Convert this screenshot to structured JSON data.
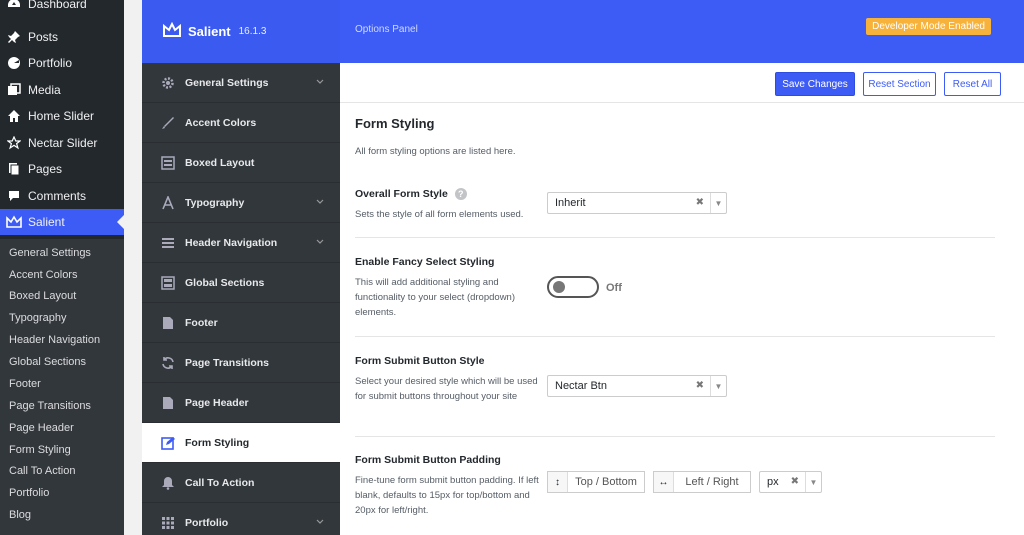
{
  "wp_menu": {
    "items": [
      {
        "label": "Dashboard",
        "icon": "dashboard-icon"
      },
      {
        "label": "Posts",
        "icon": "pin-icon"
      },
      {
        "label": "Portfolio",
        "icon": "portfolio-icon"
      },
      {
        "label": "Media",
        "icon": "media-icon"
      },
      {
        "label": "Home Slider",
        "icon": "home-icon"
      },
      {
        "label": "Nectar Slider",
        "icon": "star-icon"
      },
      {
        "label": "Pages",
        "icon": "pages-icon"
      },
      {
        "label": "Comments",
        "icon": "comments-icon"
      },
      {
        "label": "Salient",
        "icon": "crown-icon"
      }
    ],
    "submenu": [
      "General Settings",
      "Accent Colors",
      "Boxed Layout",
      "Typography",
      "Header Navigation",
      "Global Sections",
      "Footer",
      "Page Transitions",
      "Page Header",
      "Form Styling",
      "Call To Action",
      "Portfolio",
      "Blog"
    ]
  },
  "header": {
    "brand": "Salient",
    "version": "16.1.3",
    "options_panel": "Options Panel",
    "dev_badge": "Developer Mode Enabled"
  },
  "sidebar": {
    "items": [
      {
        "label": "General Settings",
        "icon": "gear-icon",
        "chevron": true
      },
      {
        "label": "Accent Colors",
        "icon": "brush-icon",
        "chevron": false
      },
      {
        "label": "Boxed Layout",
        "icon": "boxed-layout-icon",
        "chevron": false
      },
      {
        "label": "Typography",
        "icon": "typography-icon",
        "chevron": true
      },
      {
        "label": "Header Navigation",
        "icon": "menu-icon",
        "chevron": true
      },
      {
        "label": "Global Sections",
        "icon": "sections-icon",
        "chevron": false
      },
      {
        "label": "Footer",
        "icon": "footer-icon",
        "chevron": false
      },
      {
        "label": "Page Transitions",
        "icon": "refresh-icon",
        "chevron": false
      },
      {
        "label": "Page Header",
        "icon": "page-header-icon",
        "chevron": false
      },
      {
        "label": "Form Styling",
        "icon": "edit-icon",
        "chevron": false
      },
      {
        "label": "Call To Action",
        "icon": "bell-icon",
        "chevron": false
      },
      {
        "label": "Portfolio",
        "icon": "grid-icon",
        "chevron": true
      }
    ]
  },
  "toolbar": {
    "save": "Save Changes",
    "reset_section": "Reset Section",
    "reset_all": "Reset All"
  },
  "section": {
    "title": "Form Styling",
    "description": "All form styling options are listed here."
  },
  "fields": {
    "overall": {
      "label": "Overall Form Style",
      "help": "?",
      "desc": "Sets the style of all form elements used.",
      "value": "Inherit"
    },
    "fancy": {
      "label": "Enable Fancy Select Styling",
      "desc": "This will add additional styling and functionality to your select (dropdown) elements.",
      "state": "Off"
    },
    "submit_style": {
      "label": "Form Submit Button Style",
      "desc": "Select your desired style which will be used for submit buttons throughout your site",
      "value": "Nectar Btn"
    },
    "padding": {
      "label": "Form Submit Button Padding",
      "desc": "Fine-tune form submit button padding. If left blank, defaults to 15px for top/bottom and 20px for left/right.",
      "top_bottom": "Top / Bottom",
      "left_right": "Left / Right",
      "unit": "px"
    }
  },
  "colors": {
    "accent": "#3d5cf5",
    "badge": "#f7b23b",
    "admin_bg": "#23282d"
  }
}
